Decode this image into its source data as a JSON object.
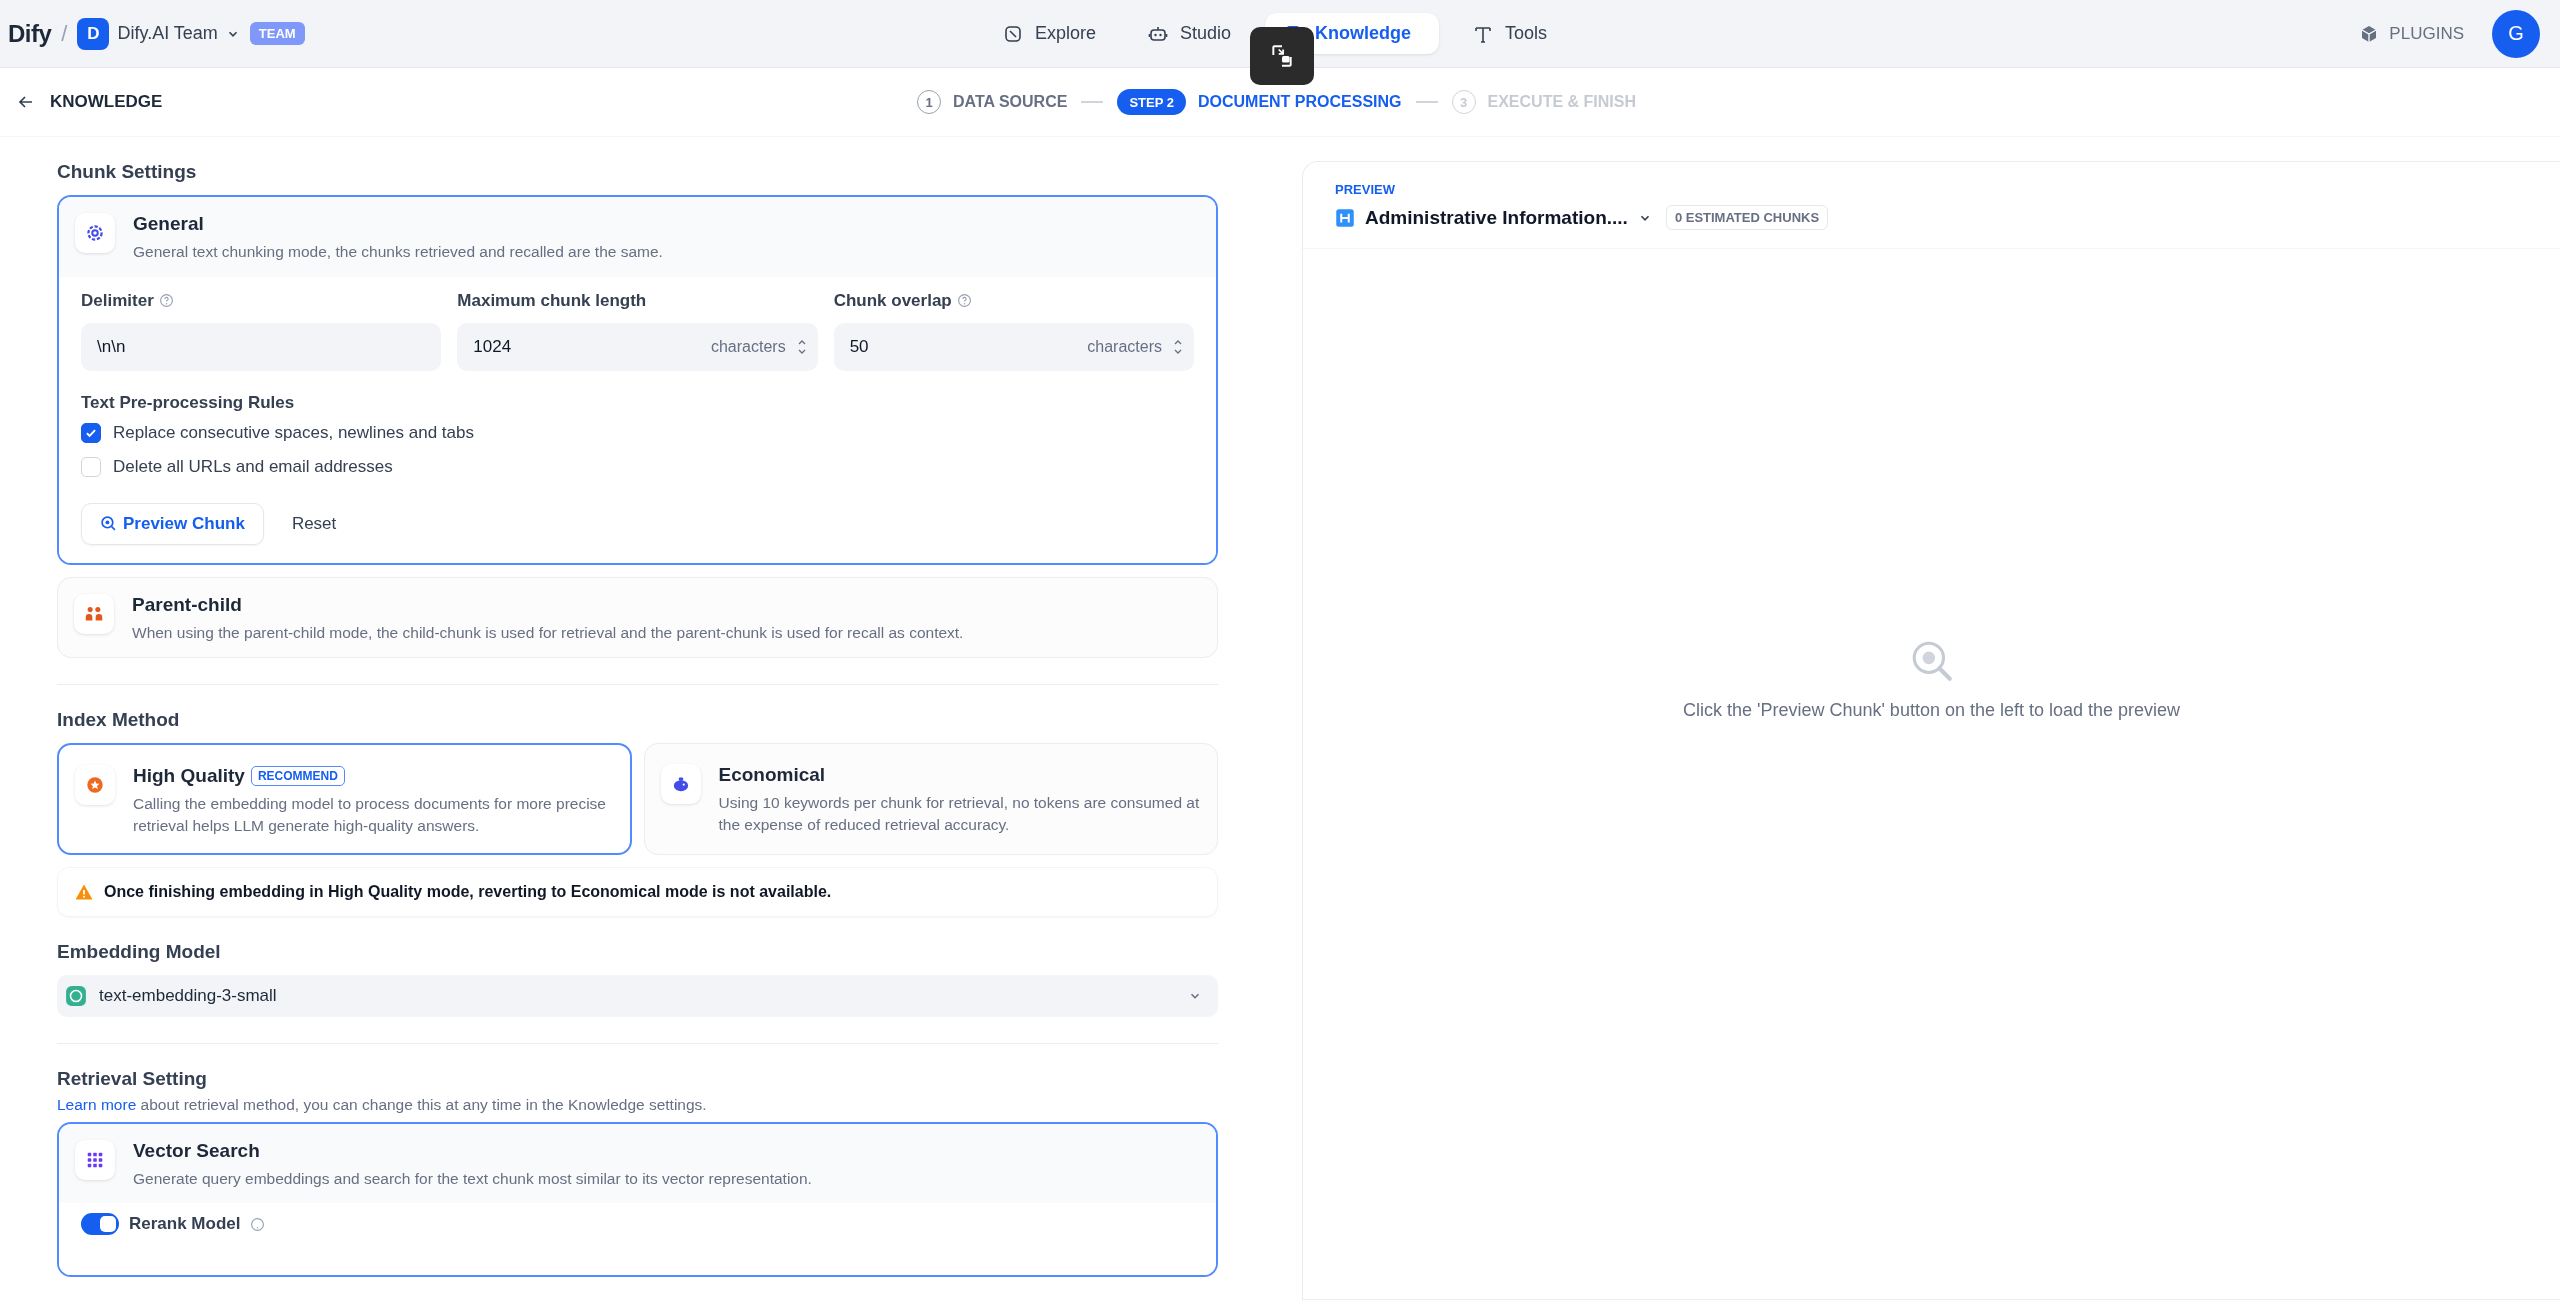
{
  "header": {
    "logo": "Dify",
    "separator": "/",
    "workspace": {
      "initial": "D",
      "name": "Dify.AI Team",
      "badge": "TEAM"
    },
    "nav": [
      {
        "kind": "explore",
        "label": "Explore",
        "selected": false
      },
      {
        "kind": "studio",
        "label": "Studio",
        "selected": false
      },
      {
        "kind": "knowledge",
        "label": "Knowledge",
        "selected": true
      },
      {
        "kind": "tools",
        "label": "Tools",
        "selected": false
      }
    ],
    "plugins": "PLUGINS",
    "avatar": "G"
  },
  "subheader": {
    "back": "KNOWLEDGE",
    "steps": [
      {
        "number": "1",
        "label": "DATA SOURCE",
        "completed": true,
        "selected": false
      },
      {
        "number": "STEP 2",
        "label": "DOCUMENT PROCESSING",
        "selected": true
      },
      {
        "number": "3",
        "label": "EXECUTE & FINISH",
        "completed": false,
        "selected": false
      }
    ]
  },
  "chunk_settings": {
    "title": "Chunk Settings",
    "modes": [
      {
        "kind": "general",
        "title": "General",
        "description": "General text chunking mode, the chunks retrieved and recalled are the same.",
        "selected": true,
        "fields": [
          {
            "label": "Delimiter",
            "help": true,
            "value": "\\n\\n"
          },
          {
            "label": "Maximum chunk length",
            "help": false,
            "value": "1024",
            "unit": "characters"
          },
          {
            "label": "Chunk overlap",
            "help": true,
            "value": "50",
            "unit": "characters"
          }
        ],
        "rules_title": "Text Pre-processing Rules",
        "rules": [
          {
            "label": "Replace consecutive spaces, newlines and tabs",
            "checked": true
          },
          {
            "label": "Delete all URLs and email addresses",
            "checked": false
          }
        ],
        "buttons": [
          {
            "kind": "preview",
            "label": "Preview Chunk"
          },
          {
            "kind": "reset",
            "label": "Reset"
          }
        ]
      },
      {
        "kind": "parent-child",
        "title": "Parent-child",
        "description": "When using the parent-child mode, the child-chunk is used for retrieval and the parent-chunk is used for recall as context.",
        "selected": false
      }
    ]
  },
  "index_method": {
    "title": "Index Method",
    "options": [
      {
        "kind": "high-quality",
        "title": "High Quality",
        "badge": "RECOMMEND",
        "description": "Calling the embedding model to process documents for more precise retrieval helps LLM generate high-quality answers.",
        "selected": true
      },
      {
        "kind": "economical",
        "title": "Economical",
        "description": "Using 10 keywords per chunk for retrieval, no tokens are consumed at the expense of reduced retrieval accuracy.",
        "selected": false
      }
    ],
    "warning": "Once finishing embedding in High Quality mode, reverting to Economical mode is not available."
  },
  "embedding_model": {
    "title": "Embedding Model",
    "value": "text-embedding-3-small"
  },
  "retrieval": {
    "title": "Retrieval Setting",
    "link": "Learn more",
    "note": "about retrieval method, you can change this at any time in the Knowledge settings.",
    "options": [
      {
        "kind": "vector",
        "title": "Vector Search",
        "description": "Generate query embeddings and search for the text chunk most similar to its vector representation.",
        "selected": true,
        "rerank": {
          "label": "Rerank Model",
          "on": true
        }
      }
    ]
  },
  "preview": {
    "label": "PREVIEW",
    "document": "Administrative Information....",
    "chunks": "0 ESTIMATED CHUNKS",
    "empty": "Click the 'Preview Chunk' button on the left to load the preview"
  }
}
